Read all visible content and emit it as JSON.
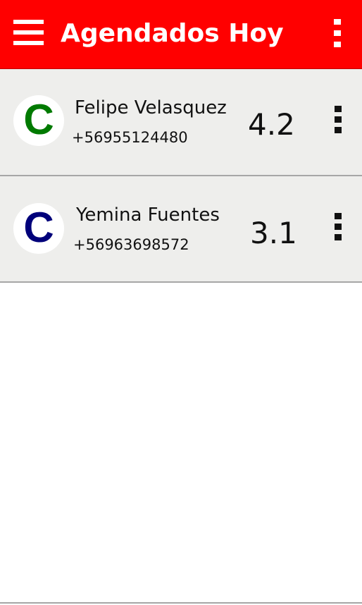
{
  "app_bar": {
    "title": "Agendados Hoy",
    "menu_icon": "hamburger-menu-icon",
    "overflow_icon": "vertical-dots-icon",
    "background_color": "#ff0000"
  },
  "contacts": [
    {
      "avatar_letter": "C",
      "avatar_color": "#007a00",
      "name": "Felipe Velasquez",
      "phone": "+56955124480",
      "score": "4.2",
      "menu_icon": "vertical-dots-icon"
    },
    {
      "avatar_letter": "C",
      "avatar_color": "#00007a",
      "name": "Yemina Fuentes",
      "phone": "+56963698572",
      "score": "3.1",
      "menu_icon": "vertical-dots-icon"
    }
  ]
}
